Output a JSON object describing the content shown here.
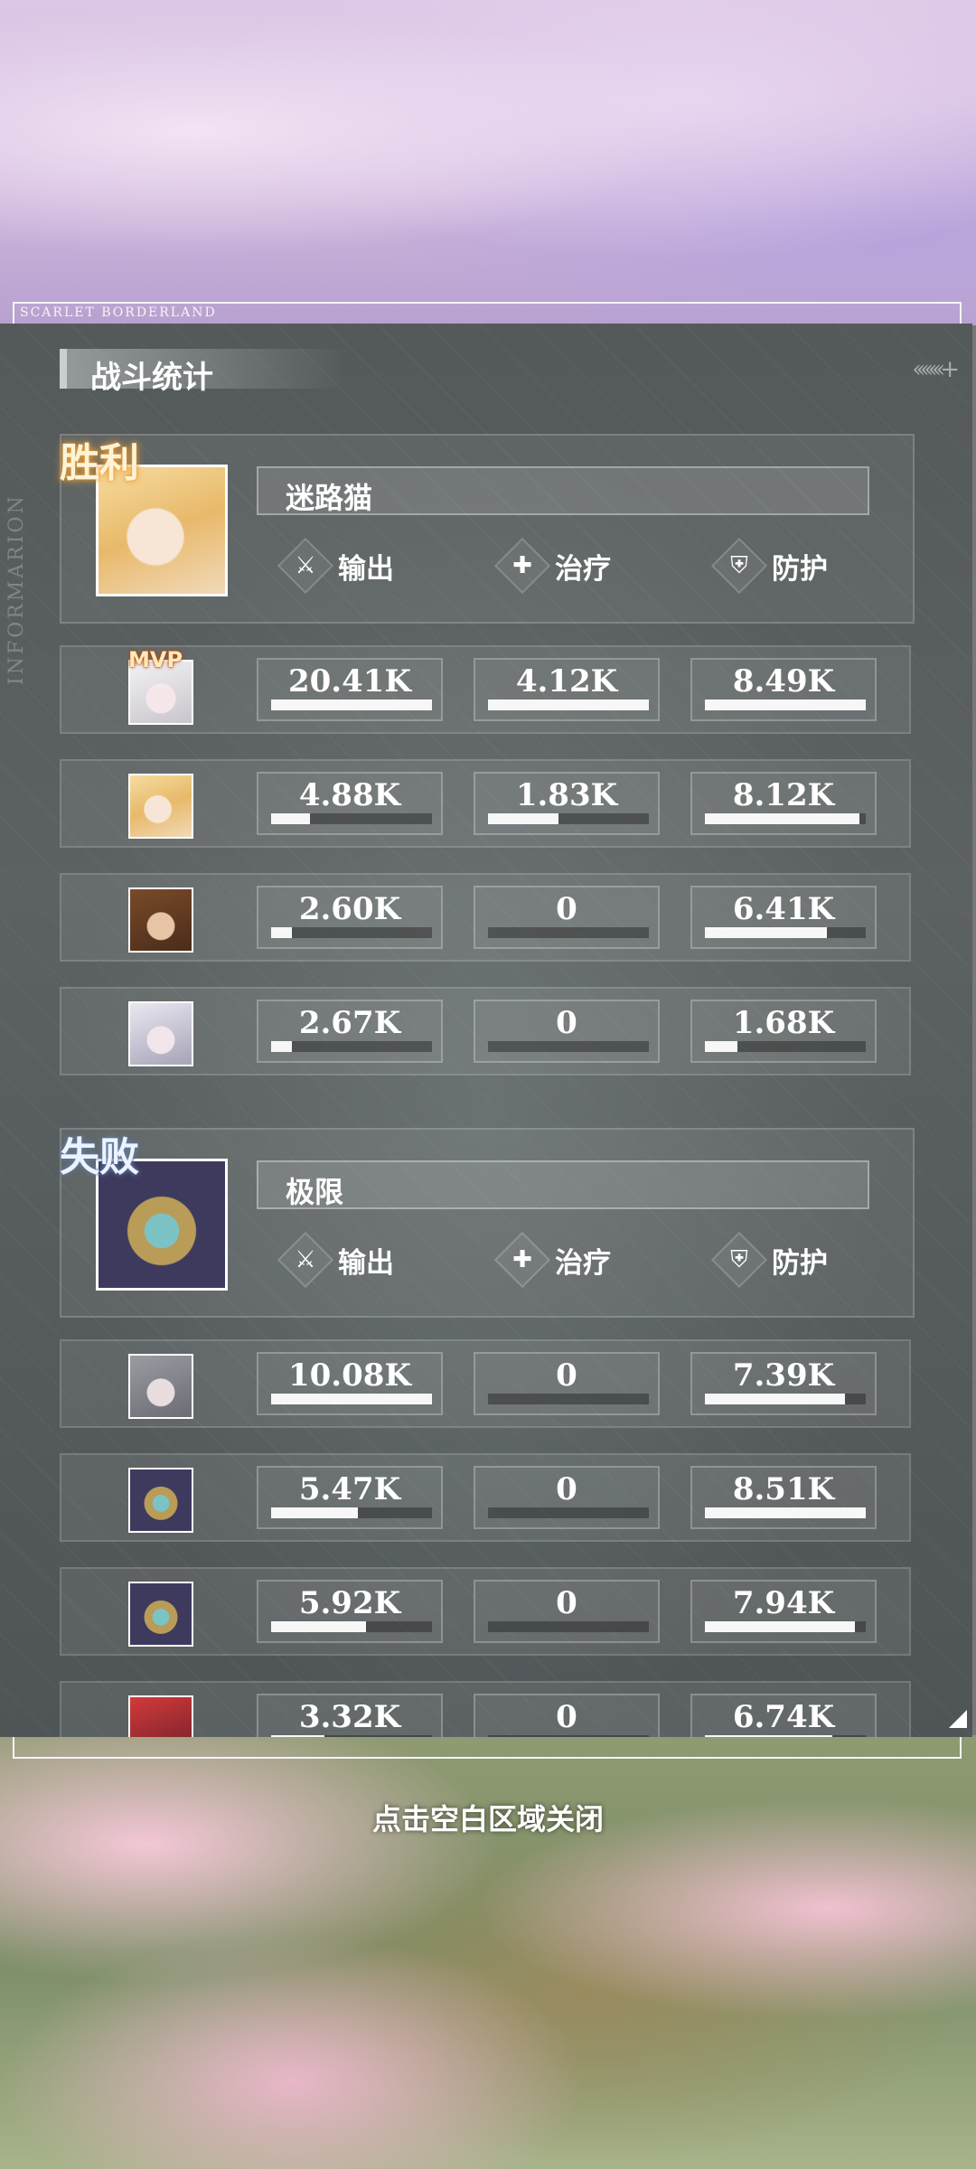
{
  "brand": "SCARLET BORDERLAND",
  "side_text": "INFORMARION",
  "title": "战斗统计",
  "close_hint": "点击空白区域关闭",
  "stat_labels": {
    "output": "输出",
    "heal": "治疗",
    "defense": "防护"
  },
  "mvp_label": "MVP",
  "teams": [
    {
      "result": "胜利",
      "name": "迷路猫",
      "avatar": "blonde-girl",
      "rows": [
        {
          "avatar": "white-hair-girl",
          "mvp": true,
          "output": "20.41K",
          "heal": "4.12K",
          "defense": "8.49K",
          "output_pct": 100,
          "heal_pct": 100,
          "defense_pct": 100
        },
        {
          "avatar": "blonde-girl",
          "mvp": false,
          "output": "4.88K",
          "heal": "1.83K",
          "defense": "8.12K",
          "output_pct": 24,
          "heal_pct": 44,
          "defense_pct": 96
        },
        {
          "avatar": "brown-hair-boy",
          "mvp": false,
          "output": "2.60K",
          "heal": "0",
          "defense": "6.41K",
          "output_pct": 13,
          "heal_pct": 0,
          "defense_pct": 76
        },
        {
          "avatar": "silver-hair-girl",
          "mvp": false,
          "output": "2.67K",
          "heal": "0",
          "defense": "1.68K",
          "output_pct": 13,
          "heal_pct": 0,
          "defense_pct": 20
        }
      ]
    },
    {
      "result": "失败",
      "name": "极限",
      "avatar": "armored-robot",
      "rows": [
        {
          "avatar": "gray-hair-girl",
          "output": "10.08K",
          "heal": "0",
          "defense": "7.39K",
          "output_pct": 100,
          "heal_pct": 0,
          "defense_pct": 87
        },
        {
          "avatar": "armored-robot",
          "output": "5.47K",
          "heal": "0",
          "defense": "8.51K",
          "output_pct": 54,
          "heal_pct": 0,
          "defense_pct": 100
        },
        {
          "avatar": "armored-robot",
          "output": "5.92K",
          "heal": "0",
          "defense": "7.94K",
          "output_pct": 59,
          "heal_pct": 0,
          "defense_pct": 93
        },
        {
          "avatar": "red-hair-unit",
          "output": "3.32K",
          "heal": "0",
          "defense": "6.74K",
          "output_pct": 33,
          "heal_pct": 0,
          "defense_pct": 79
        }
      ]
    }
  ],
  "icons": {
    "output": "crossed-swords-icon",
    "heal": "heal-arrow-icon",
    "defense": "shield-icon"
  }
}
